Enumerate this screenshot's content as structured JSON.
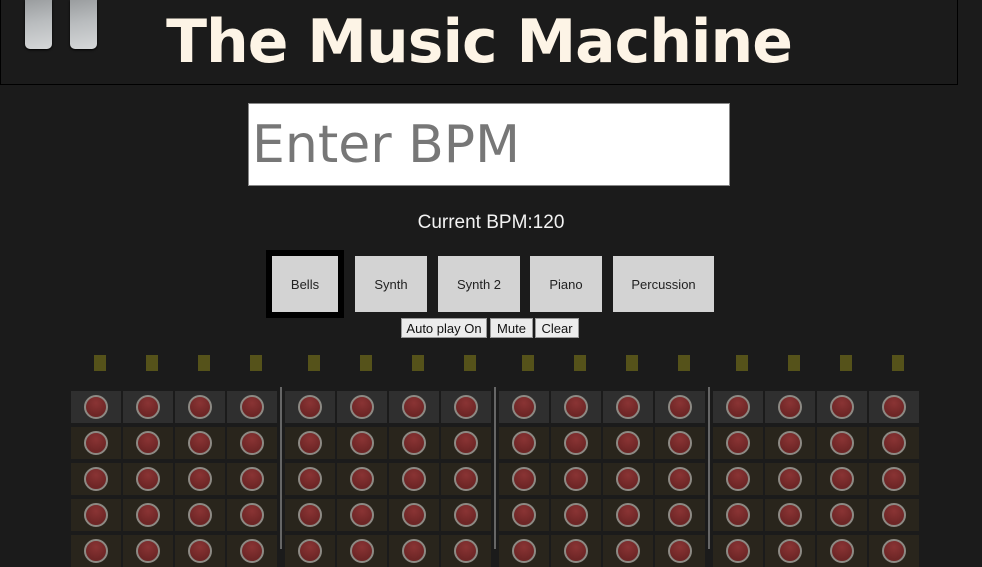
{
  "header": {
    "title": "The Music Machine",
    "pause_icon": "pause-icon"
  },
  "bpm_input": {
    "placeholder": "Enter BPM",
    "value": ""
  },
  "current_bpm": {
    "label": "Current BPM:120"
  },
  "instruments": [
    {
      "label": "Bells",
      "selected": true
    },
    {
      "label": "Synth",
      "selected": false
    },
    {
      "label": "Synth 2",
      "selected": false
    },
    {
      "label": "Piano",
      "selected": false
    },
    {
      "label": "Percussion",
      "selected": false
    }
  ],
  "controls": {
    "autoplay": "Auto play On",
    "mute": "Mute",
    "clear": "Clear"
  },
  "sequencer": {
    "steps": 16,
    "visible_rows": 5,
    "active": [],
    "colors": {
      "indicator": "#55521a",
      "pad": "#7a2b2b",
      "row_highlight": "#2f2f2f",
      "row": "#29251c"
    }
  }
}
